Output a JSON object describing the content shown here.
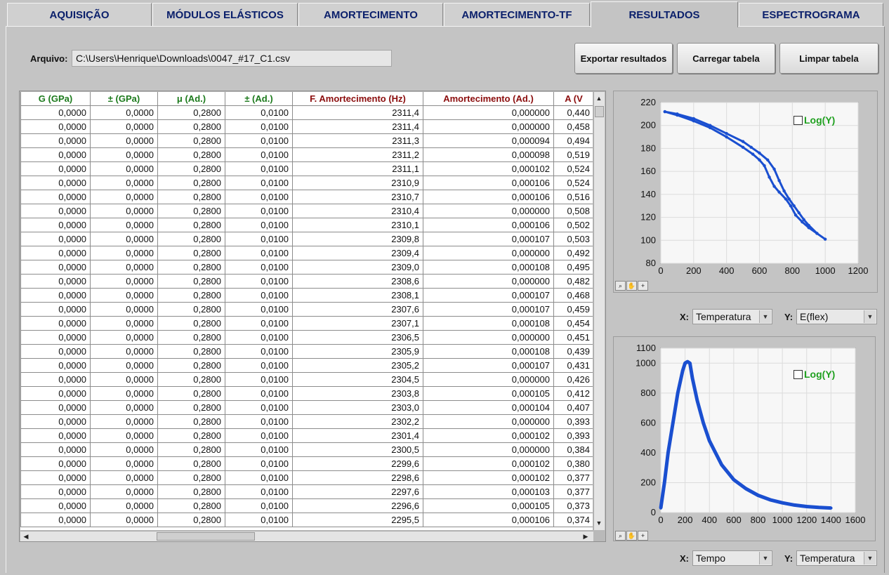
{
  "tabs": [
    "AQUISIÇÃO",
    "MÓDULOS ELÁSTICOS",
    "AMORTECIMENTO",
    "AMORTECIMENTO-TF",
    "RESULTADOS",
    "ESPECTROGRAMA"
  ],
  "file": {
    "label": "Arquivo:",
    "value": "C:\\Users\\Henrique\\Downloads\\0047_#17_C1.csv"
  },
  "buttons": {
    "export": "Exportar resultados",
    "load": "Carregar tabela",
    "clear": "Limpar tabela"
  },
  "table": {
    "columns": [
      "G (GPa)",
      "± (GPa)",
      "μ (Ad.)",
      "± (Ad.)",
      "F. Amortecimento (Hz)",
      "Amortecimento (Ad.)",
      "A (V"
    ],
    "header_colors": [
      "#1c7a1c",
      "#1c7a1c",
      "#1c7a1c",
      "#1c7a1c",
      "#8b0d0d",
      "#8b0d0d",
      "#8b0d0d"
    ],
    "rows": [
      [
        "0,0000",
        "0,0000",
        "0,2800",
        "0,0100",
        "2311,4",
        "0,000000",
        "0,440"
      ],
      [
        "0,0000",
        "0,0000",
        "0,2800",
        "0,0100",
        "2311,4",
        "0,000000",
        "0,458"
      ],
      [
        "0,0000",
        "0,0000",
        "0,2800",
        "0,0100",
        "2311,3",
        "0,000094",
        "0,494"
      ],
      [
        "0,0000",
        "0,0000",
        "0,2800",
        "0,0100",
        "2311,2",
        "0,000098",
        "0,519"
      ],
      [
        "0,0000",
        "0,0000",
        "0,2800",
        "0,0100",
        "2311,1",
        "0,000102",
        "0,524"
      ],
      [
        "0,0000",
        "0,0000",
        "0,2800",
        "0,0100",
        "2310,9",
        "0,000106",
        "0,524"
      ],
      [
        "0,0000",
        "0,0000",
        "0,2800",
        "0,0100",
        "2310,7",
        "0,000106",
        "0,516"
      ],
      [
        "0,0000",
        "0,0000",
        "0,2800",
        "0,0100",
        "2310,4",
        "0,000000",
        "0,508"
      ],
      [
        "0,0000",
        "0,0000",
        "0,2800",
        "0,0100",
        "2310,1",
        "0,000106",
        "0,502"
      ],
      [
        "0,0000",
        "0,0000",
        "0,2800",
        "0,0100",
        "2309,8",
        "0,000107",
        "0,503"
      ],
      [
        "0,0000",
        "0,0000",
        "0,2800",
        "0,0100",
        "2309,4",
        "0,000000",
        "0,492"
      ],
      [
        "0,0000",
        "0,0000",
        "0,2800",
        "0,0100",
        "2309,0",
        "0,000108",
        "0,495"
      ],
      [
        "0,0000",
        "0,0000",
        "0,2800",
        "0,0100",
        "2308,6",
        "0,000000",
        "0,482"
      ],
      [
        "0,0000",
        "0,0000",
        "0,2800",
        "0,0100",
        "2308,1",
        "0,000107",
        "0,468"
      ],
      [
        "0,0000",
        "0,0000",
        "0,2800",
        "0,0100",
        "2307,6",
        "0,000107",
        "0,459"
      ],
      [
        "0,0000",
        "0,0000",
        "0,2800",
        "0,0100",
        "2307,1",
        "0,000108",
        "0,454"
      ],
      [
        "0,0000",
        "0,0000",
        "0,2800",
        "0,0100",
        "2306,5",
        "0,000000",
        "0,451"
      ],
      [
        "0,0000",
        "0,0000",
        "0,2800",
        "0,0100",
        "2305,9",
        "0,000108",
        "0,439"
      ],
      [
        "0,0000",
        "0,0000",
        "0,2800",
        "0,0100",
        "2305,2",
        "0,000107",
        "0,431"
      ],
      [
        "0,0000",
        "0,0000",
        "0,2800",
        "0,0100",
        "2304,5",
        "0,000000",
        "0,426"
      ],
      [
        "0,0000",
        "0,0000",
        "0,2800",
        "0,0100",
        "2303,8",
        "0,000105",
        "0,412"
      ],
      [
        "0,0000",
        "0,0000",
        "0,2800",
        "0,0100",
        "2303,0",
        "0,000104",
        "0,407"
      ],
      [
        "0,0000",
        "0,0000",
        "0,2800",
        "0,0100",
        "2302,2",
        "0,000000",
        "0,393"
      ],
      [
        "0,0000",
        "0,0000",
        "0,2800",
        "0,0100",
        "2301,4",
        "0,000102",
        "0,393"
      ],
      [
        "0,0000",
        "0,0000",
        "0,2800",
        "0,0100",
        "2300,5",
        "0,000000",
        "0,384"
      ],
      [
        "0,0000",
        "0,0000",
        "0,2800",
        "0,0100",
        "2299,6",
        "0,000102",
        "0,380"
      ],
      [
        "0,0000",
        "0,0000",
        "0,2800",
        "0,0100",
        "2298,6",
        "0,000102",
        "0,377"
      ],
      [
        "0,0000",
        "0,0000",
        "0,2800",
        "0,0100",
        "2297,6",
        "0,000103",
        "0,377"
      ],
      [
        "0,0000",
        "0,0000",
        "0,2800",
        "0,0100",
        "2296,6",
        "0,000105",
        "0,373"
      ],
      [
        "0,0000",
        "0,0000",
        "0,2800",
        "0,0100",
        "2295,5",
        "0,000106",
        "0,374"
      ]
    ]
  },
  "chart_top_selectors": {
    "x_label": "X:",
    "x_value": "Temperatura",
    "y_label": "Y:",
    "y_value": "E(flex)"
  },
  "chart_bottom_selectors": {
    "x_label": "X:",
    "x_value": "Tempo",
    "y_label": "Y:",
    "y_value": "Temperatura"
  },
  "log_label": "Log(Y)",
  "series_color": "#1a4fd0",
  "chart_data": [
    {
      "type": "scatter",
      "title": "",
      "xlabel": "",
      "ylabel": "",
      "xlim": [
        0,
        1200
      ],
      "ylim": [
        80,
        220
      ],
      "xticks": [
        0,
        200,
        400,
        600,
        800,
        1000,
        1200
      ],
      "yticks": [
        80,
        100,
        120,
        140,
        160,
        180,
        200,
        220
      ],
      "grid": true,
      "series": [
        {
          "points": [
            [
              25,
              212
            ],
            [
              100,
              209
            ],
            [
              200,
              204
            ],
            [
              300,
              198
            ],
            [
              400,
              190
            ],
            [
              500,
              181
            ],
            [
              560,
              175
            ],
            [
              600,
              170
            ],
            [
              630,
              165
            ],
            [
              660,
              155
            ],
            [
              690,
              147
            ],
            [
              720,
              142
            ],
            [
              760,
              136
            ],
            [
              790,
              130
            ],
            [
              820,
              122
            ],
            [
              860,
              116
            ],
            [
              900,
              111
            ],
            [
              950,
              106
            ],
            [
              1000,
              101
            ],
            [
              950,
              106
            ],
            [
              900,
              113
            ],
            [
              870,
              118
            ],
            [
              840,
              124
            ],
            [
              810,
              130
            ],
            [
              780,
              136
            ],
            [
              750,
              143
            ],
            [
              720,
              152
            ],
            [
              690,
              162
            ],
            [
              650,
              170
            ],
            [
              600,
              176
            ],
            [
              550,
              181
            ],
            [
              500,
              186
            ],
            [
              400,
              193
            ],
            [
              300,
              200
            ],
            [
              200,
              206
            ],
            [
              100,
              210
            ],
            [
              25,
              212
            ]
          ]
        }
      ]
    },
    {
      "type": "scatter",
      "title": "",
      "xlabel": "",
      "ylabel": "",
      "xlim": [
        0,
        1600
      ],
      "ylim": [
        0,
        1100
      ],
      "xticks": [
        0,
        200,
        400,
        600,
        800,
        1000,
        1200,
        1400,
        1600
      ],
      "yticks": [
        0,
        200,
        400,
        600,
        800,
        1000,
        1100
      ],
      "grid": true,
      "series": [
        {
          "points": [
            [
              0,
              30
            ],
            [
              30,
              200
            ],
            [
              60,
              400
            ],
            [
              100,
              600
            ],
            [
              140,
              800
            ],
            [
              180,
              950
            ],
            [
              200,
              1000
            ],
            [
              220,
              1010
            ],
            [
              240,
              1000
            ],
            [
              260,
              900
            ],
            [
              300,
              750
            ],
            [
              350,
              600
            ],
            [
              400,
              480
            ],
            [
              500,
              320
            ],
            [
              600,
              220
            ],
            [
              700,
              160
            ],
            [
              800,
              115
            ],
            [
              900,
              85
            ],
            [
              1000,
              65
            ],
            [
              1100,
              50
            ],
            [
              1200,
              40
            ],
            [
              1300,
              34
            ],
            [
              1400,
              30
            ]
          ]
        }
      ]
    }
  ]
}
